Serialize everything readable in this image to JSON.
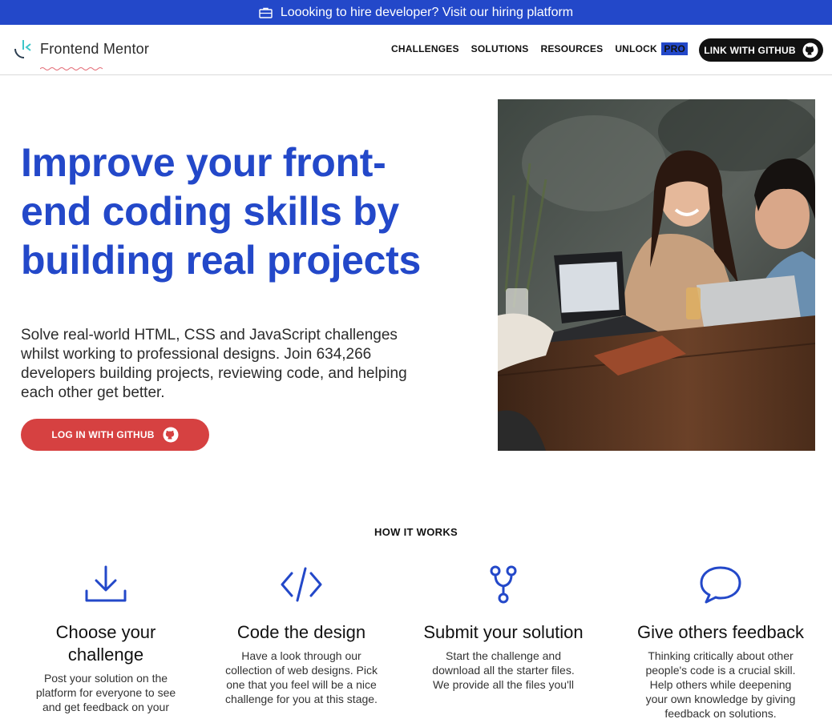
{
  "banner": {
    "icon": "briefcase-icon",
    "text": "Loooking to hire developer? Visit our hiring platform"
  },
  "nav": {
    "logo_text": "Frontend Mentor",
    "links": [
      "CHALLENGES",
      "SOLUTIONS",
      "RESOURCES"
    ],
    "unlock_label": "UNLOCK",
    "pro_label": "PRO",
    "github_label": "LINK WITH GITHUB"
  },
  "hero": {
    "title": "Improve your front-end coding skills by building real projects",
    "description": "Solve real-world HTML, CSS and JavaScript challenges whilst working to professional designs. Join 634,266 developers building projects, reviewing code, and helping each other get better.",
    "cta_label": "LOG IN WITH GITHUB"
  },
  "how_it_works": {
    "title": "HOW IT WORKS",
    "steps": [
      {
        "icon": "download-icon",
        "title": "Choose your challenge",
        "text": "Post your solution on the platform for everyone to see and get feedback on your"
      },
      {
        "icon": "code-icon",
        "title": "Code the design",
        "text": "Have a look through our collection of web designs. Pick one that you feel will be a nice challenge for you at this stage."
      },
      {
        "icon": "branch-icon",
        "title": "Submit your solution",
        "text": "Start the challenge and download all the starter files. We provide all the files you'll"
      },
      {
        "icon": "chat-bubble-icon",
        "title": "Give others feedback",
        "text": "Thinking critically about other people's code is a crucial skill. Help others while deepening your own knowledge by giving feedback on solutions."
      }
    ]
  },
  "colors": {
    "brand_blue": "#2348c9",
    "cta_red": "#d64141",
    "black": "#111111"
  }
}
